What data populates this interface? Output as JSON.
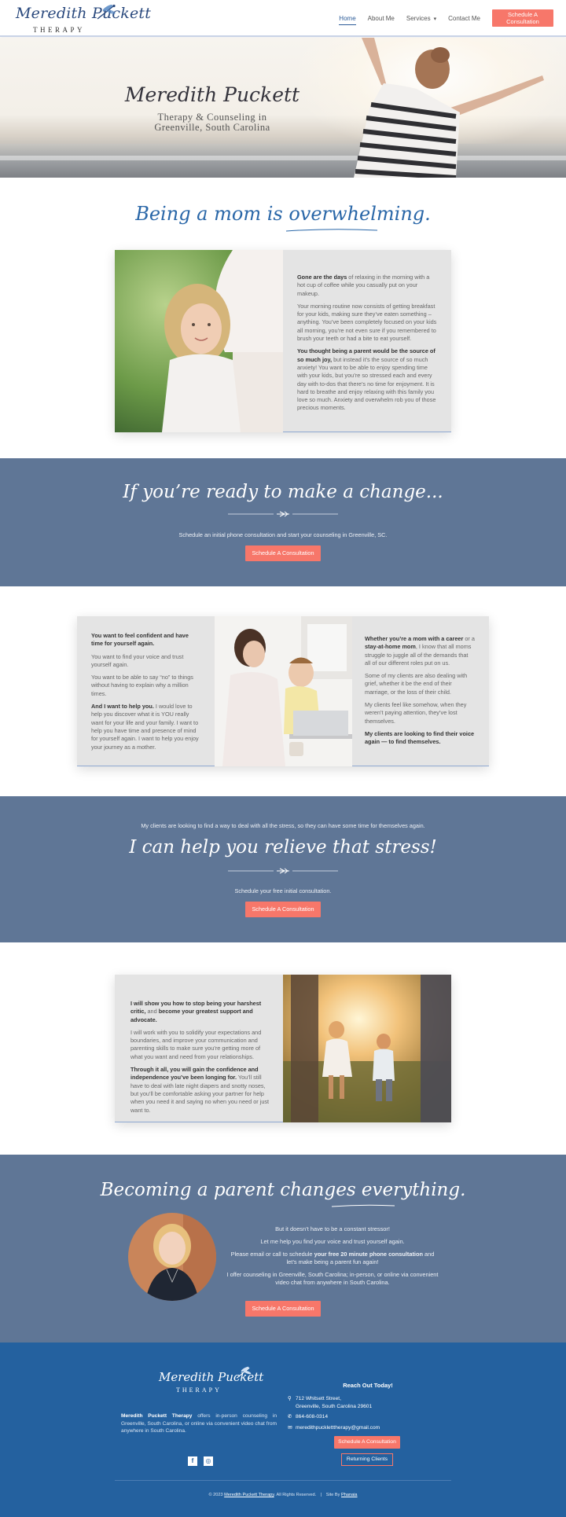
{
  "header": {
    "logo_script": "Meredith Puckett",
    "logo_sub": "THERAPY",
    "nav": [
      {
        "label": "Home",
        "active": true
      },
      {
        "label": "About Me",
        "active": false
      },
      {
        "label": "Services",
        "active": false,
        "caret": "▾"
      },
      {
        "label": "Contact Me",
        "active": false
      }
    ],
    "cta_label": "Schedule A Consultation"
  },
  "hero": {
    "title": "Meredith Puckett",
    "subtitle_line1": "Therapy & Counseling in",
    "subtitle_line2": "Greenville, South Carolina"
  },
  "section1": {
    "title": "Being a mom is overwhelming.",
    "p1_bold": "Gone are the days",
    "p1_rest": " of relaxing in the morning with a hot cup of coffee while you casually put on your makeup.",
    "p2": "Your morning routine now consists of getting breakfast for your kids, making sure they’ve eaten something – anything. You’ve been completely focused on your kids all morning, you’re not even sure if you remembered to brush your teeth or had a bite to eat yourself.",
    "p3_bold": "You thought being a parent would be the source of so much joy,",
    "p3_rest": " but instead it’s the source of so much anxiety! You want to be able to enjoy spending time with your kids, but you’re so stressed each and every day with to-dos that there’s no time for enjoyment. It is hard to breathe and enjoy relaxing with this family you love so much. Anxiety and overwhelm rob you of those precious moments."
  },
  "band1": {
    "title": "If you’re ready to make a change...",
    "text": "Schedule an initial phone consultation and start your counseling in Greenville, SC.",
    "button": "Schedule A Consultation"
  },
  "section2": {
    "left_p1_bold": "You want to feel confident and have time for yourself again.",
    "left_p2": "You want to find your voice and trust yourself again.",
    "left_p3": "You want to be able to say “no” to things without having to explain why a million times.",
    "left_p4_bold": "And I want to help you.",
    "left_p4_rest": " I would love to help you discover what it is YOU really want for your life and your family. I want to help you have time and presence of mind for yourself again. I want to help you enjoy your journey as a mother.",
    "right_p1_a": "Whether you’re a mom with a ",
    "right_p1_b_bold": "career",
    "right_p1_c": " or a ",
    "right_p1_d_bold": "stay-at-home mom",
    "right_p1_e": ", I know that all moms struggle to juggle all of the demands that all of our different roles put on us.",
    "right_p2": "Some of my clients are also dealing with grief, whether it be the end of their marriage, or the loss of their child.",
    "right_p3": "My clients feel like somehow, when they weren’t paying attention, they’ve lost themselves.",
    "right_p4_bold": "My clients are looking to find their voice again — to find themselves."
  },
  "band2": {
    "intro": "My clients are looking to find a way to deal with all the stress, so they can have some time for themselves again.",
    "title": "I can help you relieve that stress!",
    "text": "Schedule your free initial consultation.",
    "button": "Schedule A Consultation"
  },
  "section3": {
    "p1_bold_a": "I will show you how to stop being your harshest critic,",
    "p1_mid": " and ",
    "p1_bold_b": "become your greatest support and advocate.",
    "p2": "I will work with you to solidify your expectations and boundaries, and improve your communication and parenting skills to make sure you’re getting more of what you want and need from your relationships.",
    "p3_bold": "Through it all, you will gain the confidence and independence you’ve been longing for.",
    "p3_rest": " You’ll still have to deal with late night diapers and snotty noses, but you’ll be comfortable asking your partner for help when you need it and saying no when you need or just want to."
  },
  "band3": {
    "title": "Becoming a parent changes everything.",
    "line1": "But it doesn’t have to be a constant stressor!",
    "line2": "Let me help you find your voice and trust yourself again.",
    "line3_a": "Please email or call to schedule ",
    "line3_b_bold": "your free 20 minute phone consultation",
    "line3_c": " and let’s make being a parent fun again!",
    "line4": "I offer counseling in Greenville, South Carolina; in-person, or online via convenient video chat from anywhere in South Carolina.",
    "button": "Schedule A Consultation"
  },
  "footer": {
    "logo_script": "Meredith Puckett",
    "logo_sub": "THERAPY",
    "about_bold": "Meredith Puckett Therapy",
    "about_rest": " offers in-person counseling in Greenville, South Carolina, or online via convenient video chat from anywhere in South Carolina.",
    "reach_title": "Reach Out Today!",
    "address_line1": "712 Whitsett Street,",
    "address_line2": "Greenville, South Carolina 29601",
    "phone": "864-608-0314",
    "email": "meredithpuckletttherapy@gmail.com",
    "btn_schedule": "Schedule A Consultation",
    "btn_returning": "Returning Clients",
    "copyright_a": "© 2023 ",
    "copyright_link": "Meredith Puckett Therapy",
    "copyright_b": ". All Rights Reserved.",
    "sep": "|",
    "site_by_a": "Site By ",
    "site_by_link": "Phanaia",
    "social": [
      "f",
      "◎"
    ]
  },
  "colors": {
    "accent_blue": "#2a67a8",
    "band": "#5f7696",
    "footer": "#24619f",
    "coral": "#f7776a"
  }
}
